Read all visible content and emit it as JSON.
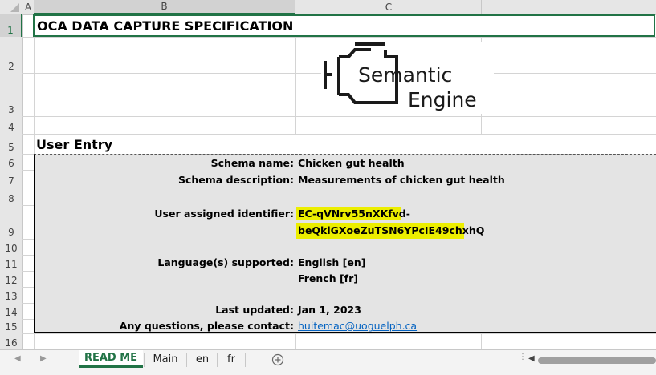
{
  "columns": [
    "A",
    "B",
    "C"
  ],
  "rows": [
    "1",
    "2",
    "3",
    "4",
    "5",
    "6",
    "7",
    "8",
    "9",
    "10",
    "11",
    "12",
    "13",
    "14",
    "15",
    "16"
  ],
  "title": "OCA DATA CAPTURE SPECIFICATION",
  "logo": {
    "line1": "Semantic",
    "line2": "Engine"
  },
  "section_heading": "User Entry",
  "fields": {
    "schema_name_label": "Schema name:",
    "schema_name_value": "Chicken gut health",
    "schema_desc_label": "Schema description:",
    "schema_desc_value": "Measurements of chicken gut health",
    "identifier_label": "User assigned identifier:",
    "identifier_value_line1": "EC-qVNrv55nXKfvd-",
    "identifier_value_line2": "beQkiGXoeZuTSN6YPcIE49chxhQ",
    "languages_label": "Language(s) supported:",
    "language_1": "English [en]",
    "language_2": "French [fr]",
    "updated_label": "Last updated:",
    "updated_value": "Jan 1, 2023",
    "contact_label": "Any questions, please contact:",
    "contact_value": "huitemac@uoguelph.ca"
  },
  "sheet_tabs": [
    "READ ME",
    "Main",
    "en",
    "fr"
  ],
  "active_tab": "READ ME",
  "colors": {
    "accent": "#217346",
    "highlight": "#ecee00",
    "panel": "#e4e4e4",
    "link": "#0563c1"
  }
}
